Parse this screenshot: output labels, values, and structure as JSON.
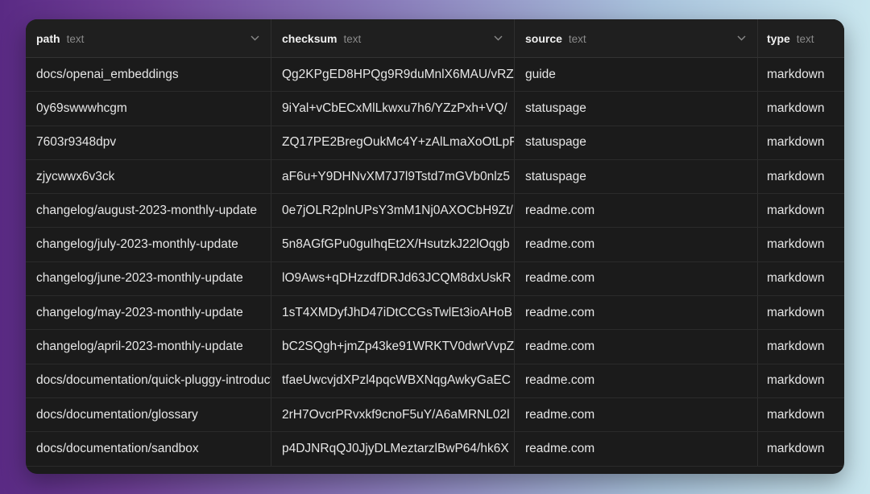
{
  "table": {
    "columns": [
      {
        "name": "path",
        "type": "text"
      },
      {
        "name": "checksum",
        "type": "text"
      },
      {
        "name": "source",
        "type": "text"
      },
      {
        "name": "type",
        "type": "text"
      }
    ],
    "rows": [
      {
        "path": "docs/openai_embeddings",
        "checksum": "Qg2KPgED8HPQg9R9duMnlX6MAU/vRZ",
        "source": "guide",
        "type": "markdown"
      },
      {
        "path": "0y69swwwhcgm",
        "checksum": "9iYal+vCbECxMlLkwxu7h6/YZzPxh+VQ/",
        "source": "statuspage",
        "type": "markdown"
      },
      {
        "path": "7603r9348dpv",
        "checksum": "ZQ17PE2BregOukMc4Y+zAlLmaXoOtLpF",
        "source": "statuspage",
        "type": "markdown"
      },
      {
        "path": "zjycwwx6v3ck",
        "checksum": "aF6u+Y9DHNvXM7J7l9Tstd7mGVb0nlz5",
        "source": "statuspage",
        "type": "markdown"
      },
      {
        "path": "changelog/august-2023-monthly-update",
        "checksum": "0e7jOLR2plnUPsY3mM1Nj0AXOCbH9Zt/",
        "source": "readme.com",
        "type": "markdown"
      },
      {
        "path": "changelog/july-2023-monthly-update",
        "checksum": "5n8AGfGPu0guIhqEt2X/HsutzkJ22lOqgb",
        "source": "readme.com",
        "type": "markdown"
      },
      {
        "path": "changelog/june-2023-monthly-update",
        "checksum": "lO9Aws+qDHzzdfDRJd63JCQM8dxUskR",
        "source": "readme.com",
        "type": "markdown"
      },
      {
        "path": "changelog/may-2023-monthly-update",
        "checksum": "1sT4XMDyfJhD47iDtCCGsTwlEt3ioAHoB",
        "source": "readme.com",
        "type": "markdown"
      },
      {
        "path": "changelog/april-2023-monthly-update",
        "checksum": "bC2SQgh+jmZp43ke91WRKTV0dwrVvpZ",
        "source": "readme.com",
        "type": "markdown"
      },
      {
        "path": "docs/documentation/quick-pluggy-introduction",
        "checksum": "tfaeUwcvjdXPzl4pqcWBXNqgAwkyGaEC",
        "source": "readme.com",
        "type": "markdown"
      },
      {
        "path": "docs/documentation/glossary",
        "checksum": "2rH7OvcrPRvxkf9cnoF5uY/A6aMRNL02l",
        "source": "readme.com",
        "type": "markdown"
      },
      {
        "path": "docs/documentation/sandbox",
        "checksum": "p4DJNRqQJ0JjyDLMeztarzlBwP64/hk6X",
        "source": "readme.com",
        "type": "markdown"
      }
    ]
  }
}
